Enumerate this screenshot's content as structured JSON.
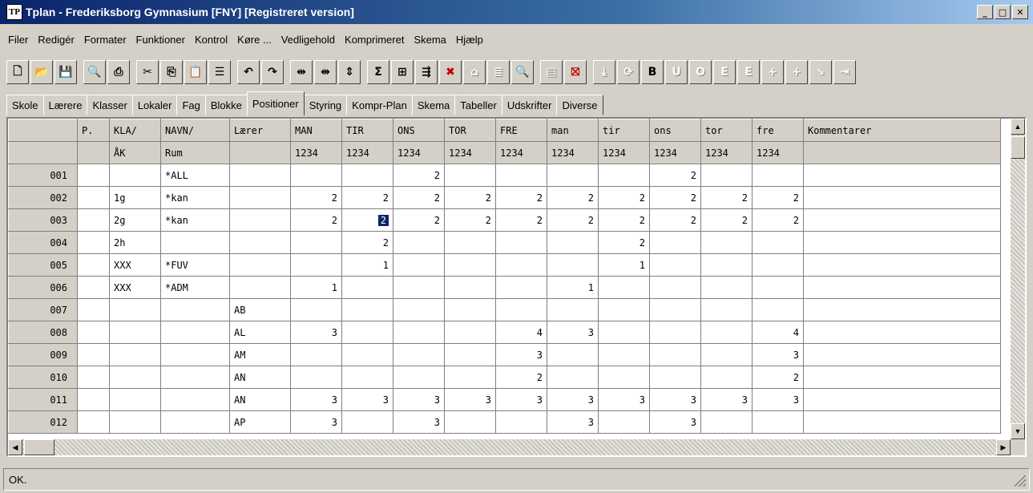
{
  "window": {
    "icon_text": "TP",
    "title": "Tplan - Frederiksborg Gymnasium [FNY]  [Registreret version]",
    "min": "_",
    "max": "□",
    "close": "✕"
  },
  "menu": [
    "Filer",
    "Redigér",
    "Formater",
    "Funktioner",
    "Kontrol",
    "Køre ...",
    "Vedligehold",
    "Komprimeret",
    "Skema",
    "Hjælp"
  ],
  "toolbar": [
    {
      "name": "new-icon",
      "glyph": "🗋"
    },
    {
      "name": "open-icon",
      "glyph": "📂"
    },
    {
      "name": "save-icon",
      "glyph": "💾"
    },
    {
      "sep": true
    },
    {
      "name": "search-icon",
      "glyph": "🔍"
    },
    {
      "name": "print-icon",
      "glyph": "⎙"
    },
    {
      "sep": true
    },
    {
      "name": "cut-icon",
      "glyph": "✂"
    },
    {
      "name": "copy-icon",
      "glyph": "⎘"
    },
    {
      "name": "paste-icon",
      "glyph": "📋"
    },
    {
      "name": "list-icon",
      "glyph": "☰"
    },
    {
      "sep": true
    },
    {
      "name": "undo-icon",
      "glyph": "↶"
    },
    {
      "name": "redo-icon",
      "glyph": "↷"
    },
    {
      "sep": true
    },
    {
      "name": "expand-h-icon",
      "glyph": "⇹"
    },
    {
      "name": "collapse-h-icon",
      "glyph": "⇼"
    },
    {
      "name": "expand-v-icon",
      "glyph": "⇕"
    },
    {
      "sep": true
    },
    {
      "name": "sum-icon",
      "glyph": "Σ"
    },
    {
      "name": "insert-row-icon",
      "glyph": "⊞"
    },
    {
      "name": "move-icon",
      "glyph": "⇶"
    },
    {
      "name": "delete-icon",
      "glyph": "✖",
      "red": true
    },
    {
      "name": "home-icon",
      "glyph": "⌂",
      "disabled": true
    },
    {
      "name": "doc-icon",
      "glyph": "≣",
      "disabled": true
    },
    {
      "name": "find-icon",
      "glyph": "🔍"
    },
    {
      "sep": true
    },
    {
      "name": "disk-icon",
      "glyph": "▤",
      "disabled": true
    },
    {
      "name": "exit-icon",
      "glyph": "⛝",
      "red": true
    },
    {
      "sep": true
    },
    {
      "name": "download-icon",
      "glyph": "⤓",
      "disabled": true
    },
    {
      "name": "refresh-icon",
      "glyph": "⟳",
      "disabled": true
    },
    {
      "name": "b-icon",
      "glyph": "B"
    },
    {
      "name": "u-icon",
      "glyph": "U",
      "disabled": true
    },
    {
      "name": "o-icon",
      "glyph": "O",
      "disabled": true
    },
    {
      "name": "e1-icon",
      "glyph": "E",
      "disabled": true
    },
    {
      "name": "e2-icon",
      "glyph": "E",
      "disabled": true
    },
    {
      "name": "plus1-icon",
      "glyph": "+",
      "disabled": true
    },
    {
      "name": "plus2-icon",
      "glyph": "+",
      "disabled": true
    },
    {
      "name": "arrow-icon",
      "glyph": "➘",
      "disabled": true
    },
    {
      "name": "end-icon",
      "glyph": "⇥",
      "disabled": true
    }
  ],
  "tabs": [
    "Skole",
    "Lærere",
    "Klasser",
    "Lokaler",
    "Fag",
    "Blokke",
    "Positioner",
    "Styring",
    "Kompr-Plan",
    "Skema",
    "Tabeller",
    "Udskrifter",
    "Diverse"
  ],
  "active_tab": 6,
  "grid": {
    "header1": [
      "",
      "P.",
      "KLA/",
      "NAVN/",
      "Lærer",
      "MAN",
      "TIR",
      "ONS",
      "TOR",
      "FRE",
      "man",
      "tir",
      "ons",
      "tor",
      "fre",
      "Kommentarer"
    ],
    "header2": [
      "",
      "",
      "ÅK",
      "Rum",
      "",
      "1234",
      "1234",
      "1234",
      "1234",
      "1234",
      "1234",
      "1234",
      "1234",
      "1234",
      "1234",
      ""
    ],
    "rows": [
      [
        "001",
        "",
        "",
        "*ALL",
        "",
        "",
        "",
        "2",
        "",
        "",
        "",
        "",
        "2",
        "",
        "",
        ""
      ],
      [
        "002",
        "",
        "1g",
        "*kan",
        "",
        "2",
        "2",
        "2",
        "2",
        "2",
        "2",
        "2",
        "2",
        "2",
        "2",
        ""
      ],
      [
        "003",
        "",
        "2g",
        "*kan",
        "",
        "2",
        "2",
        "2",
        "2",
        "2",
        "2",
        "2",
        "2",
        "2",
        "2",
        ""
      ],
      [
        "004",
        "",
        "2h",
        "",
        "",
        "",
        "2",
        "",
        "",
        "",
        "",
        "2",
        "",
        "",
        "",
        ""
      ],
      [
        "005",
        "",
        "XXX",
        "*FUV",
        "",
        "",
        "1",
        "",
        "",
        "",
        "",
        "1",
        "",
        "",
        "",
        ""
      ],
      [
        "006",
        "",
        "XXX",
        "*ADM",
        "",
        "1",
        "",
        "",
        "",
        "",
        "1",
        "",
        "",
        "",
        "",
        ""
      ],
      [
        "007",
        "",
        "",
        "",
        "AB",
        "",
        "",
        "",
        "",
        "",
        "",
        "",
        "",
        "",
        "",
        ""
      ],
      [
        "008",
        "",
        "",
        "",
        "AL",
        "3",
        "",
        "",
        "",
        "4",
        "3",
        "",
        "",
        "",
        "4",
        ""
      ],
      [
        "009",
        "",
        "",
        "",
        "AM",
        "",
        "",
        "",
        "",
        "3",
        "",
        "",
        "",
        "",
        "3",
        ""
      ],
      [
        "010",
        "",
        "",
        "",
        "AN",
        "",
        "",
        "",
        "",
        "2",
        "",
        "",
        "",
        "",
        "2",
        ""
      ],
      [
        "011",
        "",
        "",
        "",
        "AN",
        "3",
        "3",
        "3",
        "3",
        "3",
        "3",
        "3",
        "3",
        "3",
        "3",
        ""
      ],
      [
        "012",
        "",
        "",
        "",
        "AP",
        "3",
        "",
        "3",
        "",
        "",
        "3",
        "",
        "3",
        "",
        "",
        ""
      ]
    ]
  },
  "status": "OK."
}
